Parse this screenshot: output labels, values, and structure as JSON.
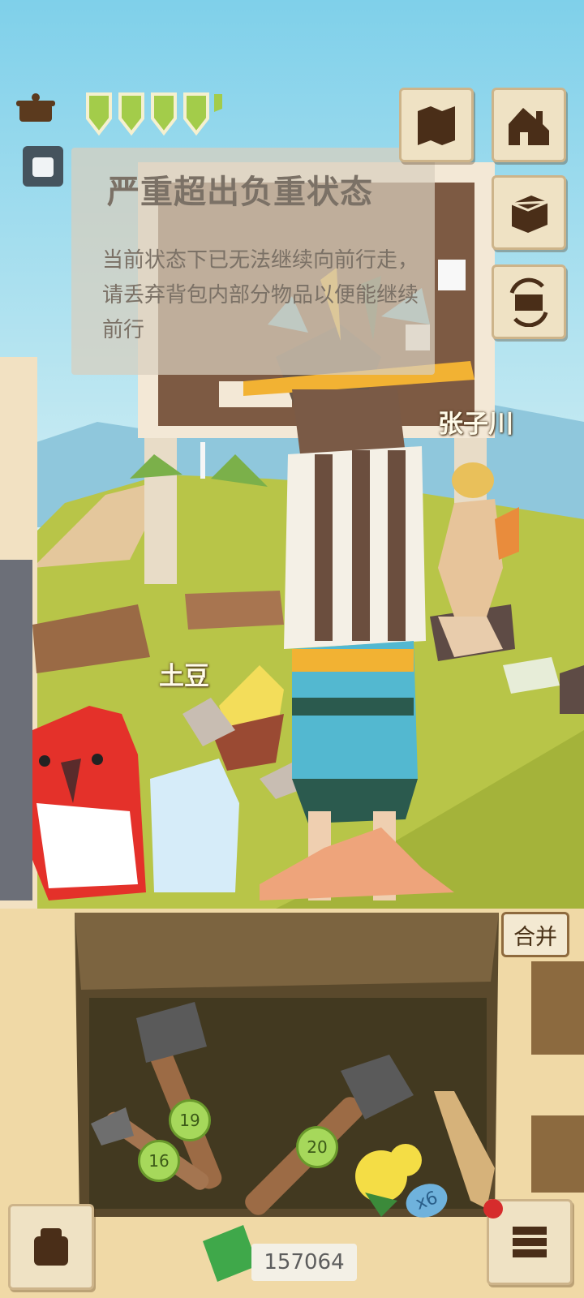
{
  "hud": {
    "hearts": 4,
    "colors": {
      "heart": "#a3cc4a",
      "heart_outline": "#f5f0d0",
      "parchment": "#efe2c4"
    }
  },
  "alert": {
    "title": "严重超出负重状态",
    "body": "当前状态下已无法继续向前行走，请丢弃背包内部分物品以便能继续前行"
  },
  "npcs": {
    "npc1": "张子川",
    "npc2": "土豆"
  },
  "menu_icons": [
    "map-icon",
    "home-icon",
    "chest-icon",
    "trade-icon",
    "backpack-icon",
    "journal-icon"
  ],
  "inventory": {
    "merge_label": "合并",
    "items": [
      {
        "name": "stone-hammer",
        "durability": "19"
      },
      {
        "name": "stone-spear",
        "durability": "16"
      },
      {
        "name": "stone-axe",
        "durability": "20"
      },
      {
        "name": "flower",
        "count": "x6"
      },
      {
        "name": "animal-horn"
      }
    ]
  },
  "currency": {
    "amount": "157064"
  }
}
